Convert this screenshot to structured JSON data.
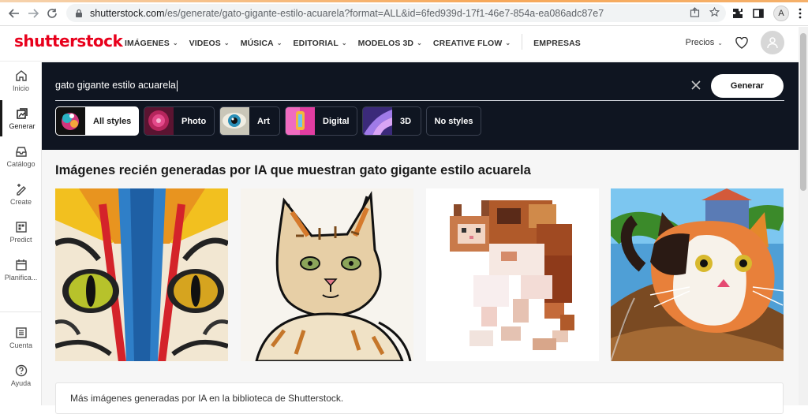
{
  "browser": {
    "url_domain": "shutterstock.com",
    "url_path": "/es/generate/gato-gigante-estilo-acuarela?format=ALL&id=6fed939d-17f1-46e7-854a-ea086adc87e7",
    "profile_initial": "A"
  },
  "header": {
    "logo": "shutterstock",
    "nav": [
      {
        "label": "IMÁGENES"
      },
      {
        "label": "VIDEOS"
      },
      {
        "label": "MÚSICA"
      },
      {
        "label": "EDITORIAL"
      },
      {
        "label": "MODELOS 3D"
      },
      {
        "label": "CREATIVE FLOW"
      }
    ],
    "enterprise": "EMPRESAS",
    "pricing": "Precios"
  },
  "sidebar": {
    "items": [
      {
        "label": "Inicio",
        "icon": "home-icon"
      },
      {
        "label": "Generar",
        "icon": "generate-icon"
      },
      {
        "label": "Catálogo",
        "icon": "catalog-icon"
      },
      {
        "label": "Create",
        "icon": "create-icon"
      },
      {
        "label": "Predict",
        "icon": "predict-icon"
      },
      {
        "label": "Planifica...",
        "icon": "calendar-icon"
      },
      {
        "label": "Cuenta",
        "icon": "account-icon"
      },
      {
        "label": "Ayuda",
        "icon": "help-icon"
      }
    ]
  },
  "generate": {
    "prompt": "gato gigante estilo acuarela",
    "button": "Generar",
    "styles": [
      {
        "label": "All styles",
        "selected": true
      },
      {
        "label": "Photo",
        "selected": false
      },
      {
        "label": "Art",
        "selected": false
      },
      {
        "label": "Digital",
        "selected": false
      },
      {
        "label": "3D",
        "selected": false
      },
      {
        "label": "No styles",
        "selected": false
      }
    ]
  },
  "main": {
    "heading": "Imágenes recién generadas por IA que muestran gato gigante estilo acuarela",
    "info": "Más imágenes generadas por IA en la biblioteca de Shutterstock."
  },
  "colors": {
    "brand": "#e8001c",
    "panel": "#0f1521"
  }
}
